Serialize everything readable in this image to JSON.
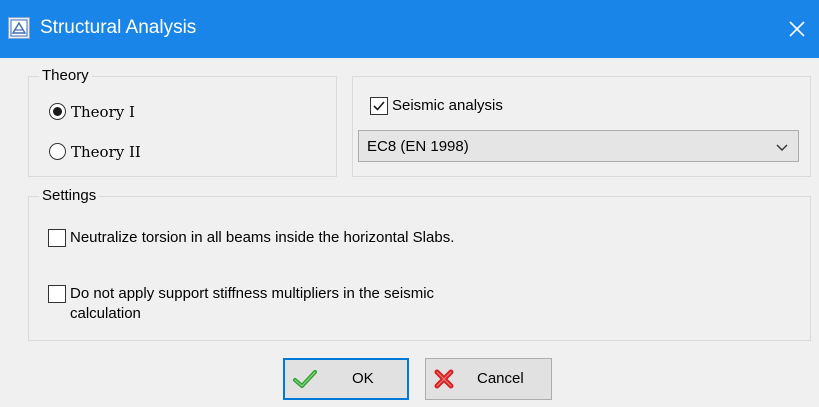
{
  "window": {
    "title": "Structural Analysis",
    "app_icon": "app-icon",
    "close_icon": "close-icon"
  },
  "theory": {
    "caption": "Theory",
    "options": [
      {
        "label": "Theory I",
        "selected": true
      },
      {
        "label": "Theory II",
        "selected": false
      }
    ]
  },
  "seismic": {
    "checkbox_label": "Seismic analysis",
    "checked": true,
    "selected_code": "EC8 (EN 1998)"
  },
  "settings": {
    "caption": "Settings",
    "options": [
      {
        "label": "Neutralize torsion in all beams inside the horizontal Slabs.",
        "checked": false
      },
      {
        "label_line1": "Do not apply support stiffness multipliers in the seismic",
        "label_line2": "calculation",
        "checked": false
      }
    ]
  },
  "buttons": {
    "ok_label": "OK",
    "cancel_label": "Cancel",
    "ok_icon": "check-icon",
    "cancel_icon": "cross-icon"
  },
  "colors": {
    "titlebar": "#1a85e8",
    "default_button_border": "#0078d7"
  }
}
